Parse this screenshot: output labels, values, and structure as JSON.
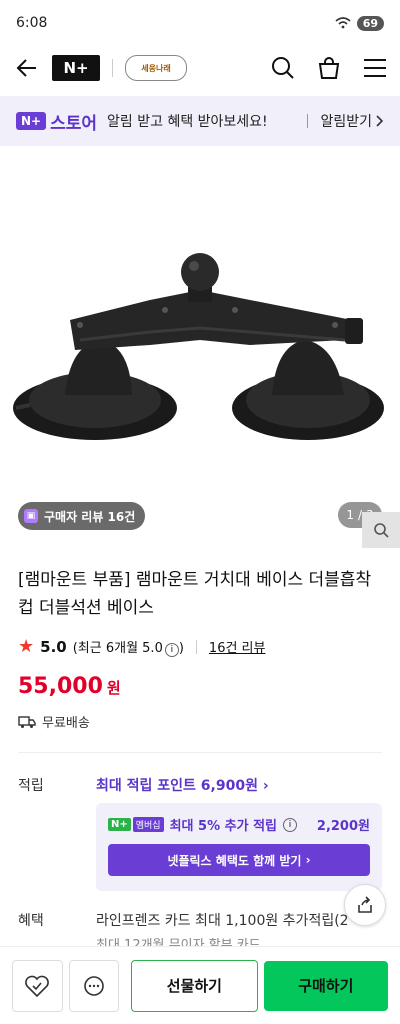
{
  "status": {
    "time": "6:08",
    "battery": "69"
  },
  "header": {
    "brand": "N+",
    "store_logo_text": "세웅나래"
  },
  "banner": {
    "badge": "N+",
    "store": "스토어",
    "text": "알림 받고 혜택 받아보세요!",
    "action": "알림받기"
  },
  "gallery": {
    "review_pill": "구매자 리뷰 16건",
    "page_current": "1",
    "page_total": "3"
  },
  "product": {
    "title": "[램마운트 부품] 램마운트 거치대 베이스 더블흡착컵 더블석션 베이스",
    "rating": "5.0",
    "rating_detail": "(최근 6개월 5.0",
    "rating_detail_close": ")",
    "review_count": "16건 리뷰",
    "price": "55,000",
    "currency": "원",
    "shipping": "무료배송"
  },
  "points": {
    "label": "적립",
    "max_points": "최대 적립 포인트 6,900원",
    "badge": "N+",
    "badge2": "멤버십",
    "extra": "최대 5% 추가 적립",
    "extra_amount": "2,200원",
    "netflix": "넷플릭스 혜택도 함께 받기"
  },
  "benefit": {
    "label": "혜택",
    "text": "라인프렌즈 카드 최대 1,100원 추가적립(2",
    "text2": "최대 12개월 무이자 할부 카드"
  },
  "bottom": {
    "gift": "선물하기",
    "buy": "구매하기"
  }
}
